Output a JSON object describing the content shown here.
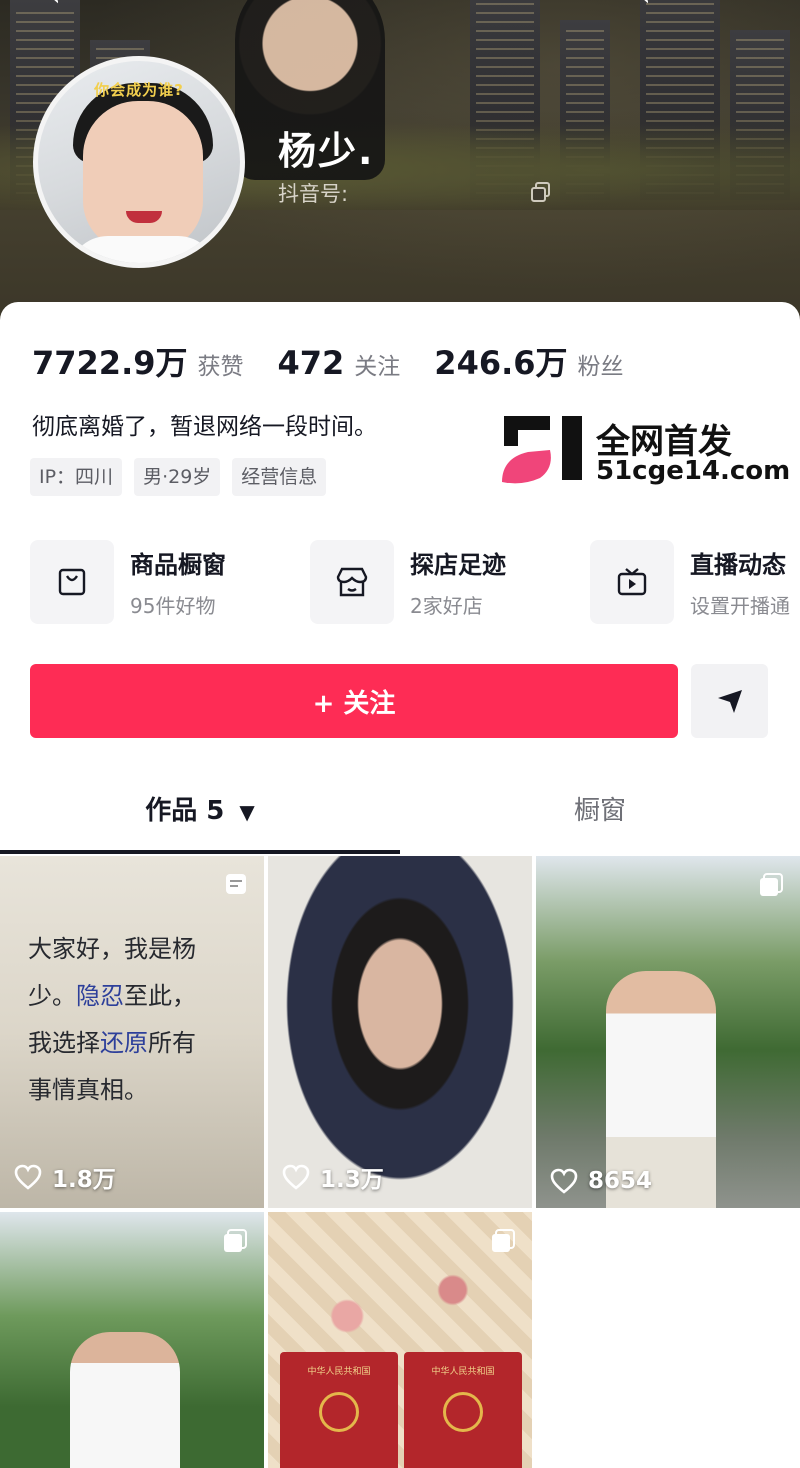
{
  "profile": {
    "nickname": "杨少.",
    "uid_label": "抖音号:",
    "avatar_caption": "你会成为谁?"
  },
  "stats": [
    {
      "value": "7722.9万",
      "label": "获赞"
    },
    {
      "value": "472",
      "label": "关注"
    },
    {
      "value": "246.6万",
      "label": "粉丝"
    }
  ],
  "bio": "彻底离婚了，暂退网络一段时间。",
  "tags": [
    "IP：四川",
    "男·29岁",
    "经营信息"
  ],
  "watermark": {
    "title": "全网首发",
    "url": "51cge14.com"
  },
  "services": [
    {
      "title": "商品橱窗",
      "subtitle": "95件好物",
      "icon": "shopping-bag-icon"
    },
    {
      "title": "探店足迹",
      "subtitle": "2家好店",
      "icon": "store-icon"
    },
    {
      "title": "直播动态",
      "subtitle": "设置开播通",
      "icon": "tv-icon"
    }
  ],
  "actions": {
    "follow": "+ 关注"
  },
  "tabs": {
    "works": "作品 5",
    "window": "橱窗"
  },
  "posts": [
    {
      "likes": "1.8万",
      "caption_lines": [
        "大家好，我是杨",
        "少。隐忍至此，",
        "我选择还原所有",
        "事情真相。"
      ]
    },
    {
      "likes": "1.3万"
    },
    {
      "likes": "8654"
    },
    {},
    {
      "cert_title": "中华人民共和国"
    }
  ],
  "colors": {
    "accent": "#fe2c55",
    "text": "#161823",
    "secondary": "#7a7b83"
  }
}
